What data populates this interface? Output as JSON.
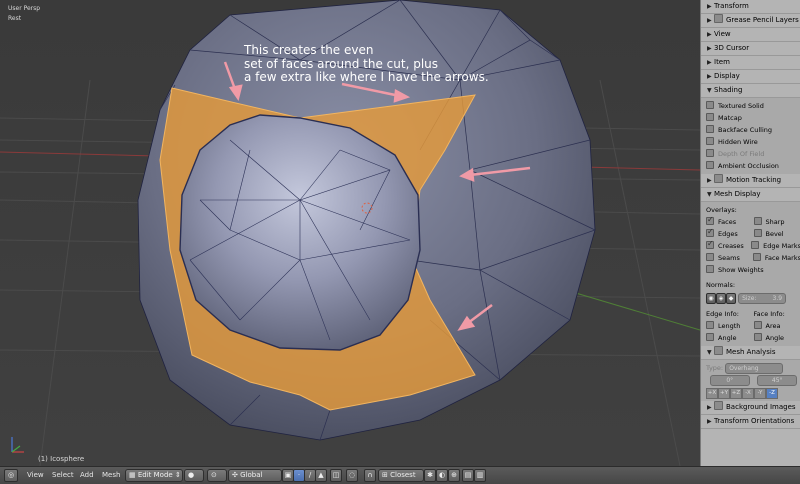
{
  "viewport": {
    "view_name": "User Persp",
    "units": "Rest",
    "object_label": "(1) Icosphere",
    "annotation_lines": [
      "This creates the even",
      "set of faces around the cut, plus",
      "a few extra like where I have the arrows."
    ],
    "colors": {
      "face_select": "#e89a2e",
      "mesh_face": "#6e7288",
      "arrow": "#f09aa6",
      "grid_x": "#8a3a3a",
      "grid_y": "#5a8a3a"
    }
  },
  "panel": {
    "sections_top": [
      {
        "label": "Transform",
        "icon": "triangle-right-icon"
      },
      {
        "label": "Grease Pencil Layers",
        "icon": "triangle-right-icon",
        "checkbox": true
      },
      {
        "label": "View",
        "icon": "triangle-right-icon"
      },
      {
        "label": "3D Cursor",
        "icon": "triangle-right-icon"
      },
      {
        "label": "Item",
        "icon": "triangle-right-icon"
      },
      {
        "label": "Display",
        "icon": "triangle-right-icon"
      }
    ],
    "shading": {
      "label": "Shading",
      "options": [
        {
          "label": "Textured Solid",
          "checked": false,
          "dim": false
        },
        {
          "label": "Matcap",
          "checked": false,
          "dim": false
        },
        {
          "label": "Backface Culling",
          "checked": false,
          "dim": false
        },
        {
          "label": "Hidden Wire",
          "checked": false,
          "dim": false
        },
        {
          "label": "Depth Of Field",
          "checked": false,
          "dim": true
        },
        {
          "label": "Ambient Occlusion",
          "checked": false,
          "dim": false
        }
      ]
    },
    "motion_tracking": {
      "label": "Motion Tracking"
    },
    "mesh_display": {
      "label": "Mesh Display",
      "overlays_label": "Overlays:",
      "overlays": [
        {
          "left": "Faces",
          "left_on": true,
          "right": "Sharp",
          "right_on": false
        },
        {
          "left": "Edges",
          "left_on": true,
          "right": "Bevel",
          "right_on": false
        },
        {
          "left": "Creases",
          "left_on": true,
          "right": "Edge Marks",
          "right_on": false
        },
        {
          "left": "Seams",
          "left_on": false,
          "right": "Face Marks",
          "right_on": false
        }
      ],
      "show_weights": "Show Weights",
      "normals_label": "Normals:",
      "size_label": "Size:",
      "size_value": "3.9",
      "edge_info_label": "Edge Info:",
      "face_info_label": "Face Info:",
      "edge_info": [
        "Length",
        "Angle"
      ],
      "face_info": [
        "Area",
        "Angle"
      ]
    },
    "mesh_analysis": {
      "label": "Mesh Analysis",
      "type_label": "Type:",
      "type_value": "Overhang",
      "min": "0°",
      "max": "45°",
      "axes": [
        "+X",
        "+Y",
        "+Z",
        "-X",
        "-Y",
        "-Z"
      ],
      "selected_axis": "-Z"
    },
    "sections_bottom": [
      {
        "label": "Background Images"
      },
      {
        "label": "Transform Orientations"
      }
    ]
  },
  "header": {
    "menus": [
      "View",
      "Select",
      "Add",
      "Mesh"
    ],
    "mode": "Edit Mode",
    "orientation": "Global",
    "snap_target": "Closest"
  }
}
